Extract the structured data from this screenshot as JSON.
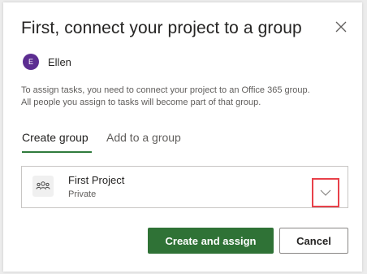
{
  "dialog": {
    "title": "First, connect your project to a group",
    "close_icon": "close-icon"
  },
  "user": {
    "avatar_initial": "E",
    "avatar_color": "#5c2d91",
    "name": "Ellen"
  },
  "description": {
    "line1": "To assign tasks, you need to connect your project to an Office 365 group.",
    "line2": "All people you assign to tasks will become part of that group."
  },
  "tabs": [
    {
      "label": "Create group",
      "active": true
    },
    {
      "label": "Add to a group",
      "active": false
    }
  ],
  "group": {
    "icon": "group-people-icon",
    "name": "First Project",
    "privacy": "Private",
    "dropdown_icon": "chevron-down-icon"
  },
  "actions": {
    "primary_label": "Create and assign",
    "secondary_label": "Cancel"
  },
  "colors": {
    "accent": "#2f7236",
    "highlight": "#e8414a"
  }
}
